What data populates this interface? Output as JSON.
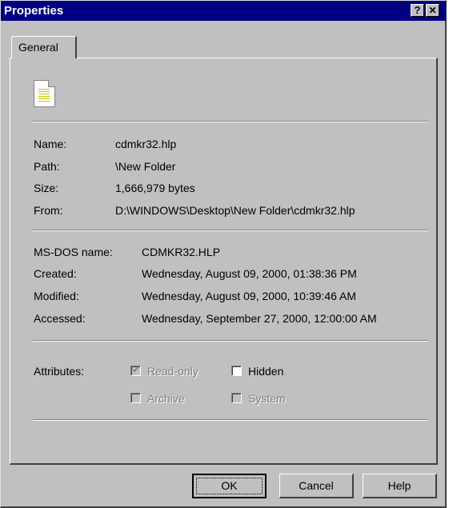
{
  "window": {
    "title": "Properties",
    "help_button": "?",
    "close_button": "✕"
  },
  "tabs": [
    {
      "label": "General",
      "active": true
    }
  ],
  "file": {
    "icon": "help-file-icon",
    "name": {
      "label": "Name:",
      "value": "cdmkr32.hlp"
    },
    "path": {
      "label": "Path:",
      "value": "\\New Folder"
    },
    "size": {
      "label": "Size:",
      "value": "1,666,979 bytes"
    },
    "from": {
      "label": "From:",
      "value": "D:\\WINDOWS\\Desktop\\New Folder\\cdmkr32.hlp"
    }
  },
  "details": {
    "msdos": {
      "label": "MS-DOS name:",
      "value": "CDMKR32.HLP"
    },
    "created": {
      "label": "Created:",
      "value": "Wednesday, August 09, 2000, 01:38:36 PM"
    },
    "modified": {
      "label": "Modified:",
      "value": "Wednesday, August 09, 2000, 10:39:46 AM"
    },
    "accessed": {
      "label": "Accessed:",
      "value": "Wednesday, September 27, 2000, 12:00:00 AM"
    }
  },
  "attributes": {
    "label": "Attributes:",
    "read_only": {
      "label": "Read-only",
      "checked": true,
      "enabled": false
    },
    "hidden": {
      "label": "Hidden",
      "checked": false,
      "enabled": true
    },
    "archive": {
      "label": "Archive",
      "checked": false,
      "enabled": false
    },
    "system": {
      "label": "System",
      "checked": false,
      "enabled": false
    }
  },
  "buttons": {
    "ok": "OK",
    "cancel": "Cancel",
    "help": "Help"
  }
}
